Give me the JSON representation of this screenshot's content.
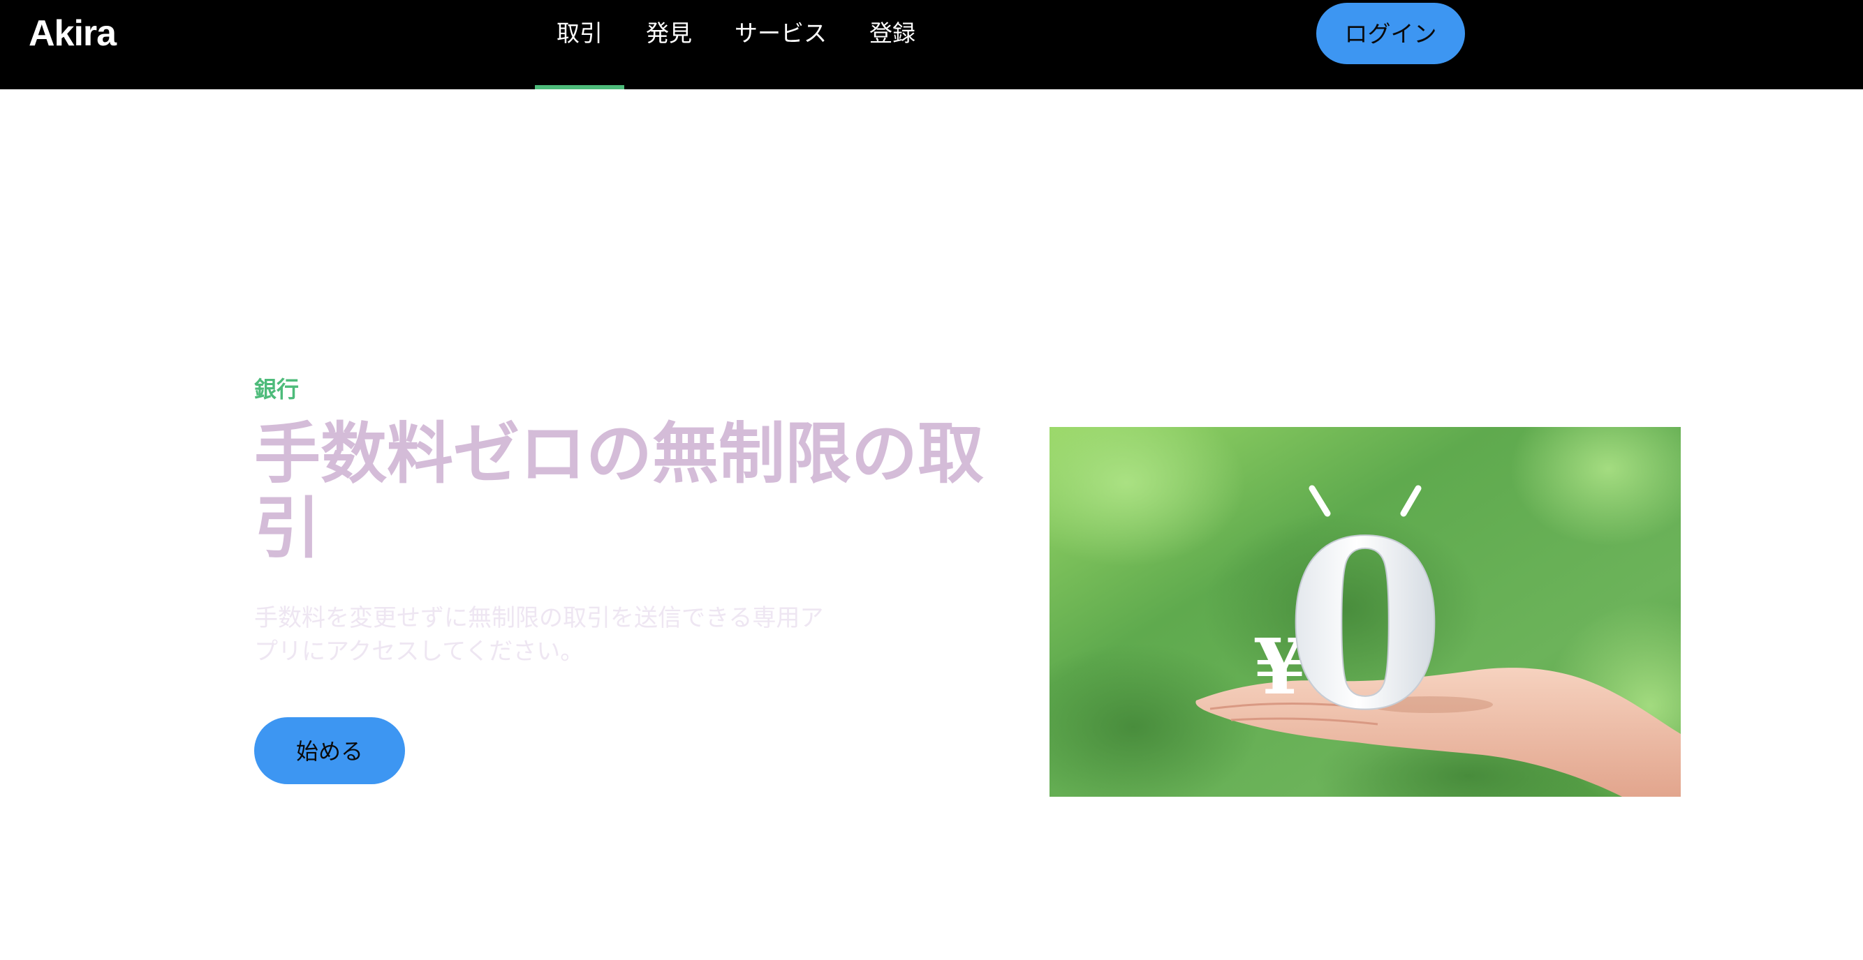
{
  "brand": {
    "name": "Akira"
  },
  "nav": {
    "items": [
      {
        "label": "取引",
        "active": true
      },
      {
        "label": "発見",
        "active": false
      },
      {
        "label": "サービス",
        "active": false
      },
      {
        "label": "登録",
        "active": false
      }
    ],
    "login_label": "ログイン"
  },
  "hero": {
    "eyebrow": "銀行",
    "headline_line1": "手数料ゼロの無制限の取",
    "headline_line2": "引",
    "subtext_line1": "手数料を変更せずに無制限の取引を送信できる専用ア",
    "subtext_line2": "プリにアクセスしてください。",
    "cta_label": "始める",
    "image": {
      "yen_symbol": "¥",
      "zero_symbol": "0"
    }
  },
  "colors": {
    "nav_background": "#000000",
    "accent_green": "#4dbb7a",
    "button_blue": "#3d96f2",
    "headline": "#d4bcd8",
    "subtext": "#eee6f2"
  }
}
